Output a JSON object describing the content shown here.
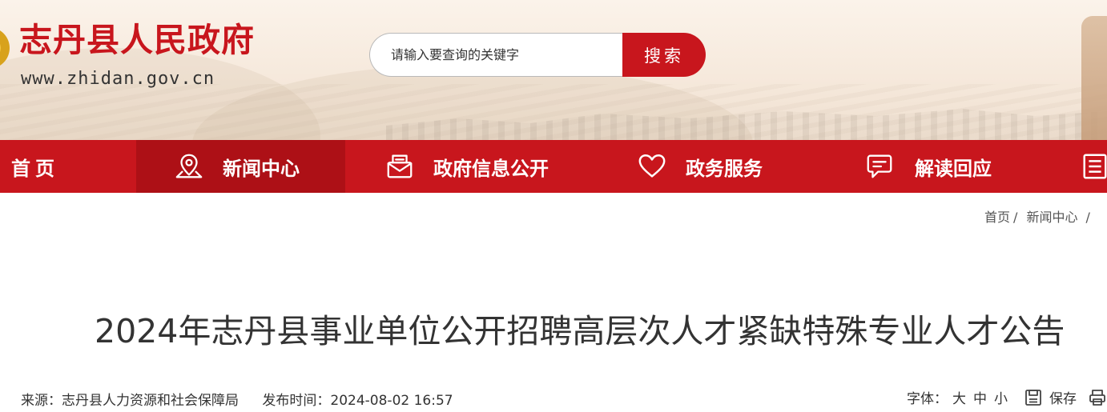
{
  "site": {
    "title": "志丹县人民政府",
    "url": "www.zhidan.gov.cn"
  },
  "search": {
    "placeholder": "请输入要查询的关键字",
    "button": "搜索"
  },
  "nav": {
    "items": [
      {
        "label": "首页",
        "icon": "none"
      },
      {
        "label": "新闻中心",
        "icon": "location-pin-icon"
      },
      {
        "label": "政府信息公开",
        "icon": "mail-icon"
      },
      {
        "label": "政务服务",
        "icon": "heart-icon"
      },
      {
        "label": "解读回应",
        "icon": "chat-icon"
      }
    ]
  },
  "breadcrumb": {
    "items": [
      "首页",
      "新闻中心"
    ],
    "separator": "/"
  },
  "article": {
    "title": "2024年志丹县事业单位公开招聘高层次人才紧缺特殊专业人才公告",
    "source_label": "来源：",
    "source": "志丹县人力资源和社会保障局",
    "date_label": "发布时间：",
    "date": "2024-08-02 16:57"
  },
  "tools": {
    "font_label": "字体：",
    "font_sizes": [
      "大",
      "中",
      "小"
    ],
    "save": "保存"
  },
  "colors": {
    "brand_red": "#c8161d",
    "active_nav": "#ad1016"
  }
}
